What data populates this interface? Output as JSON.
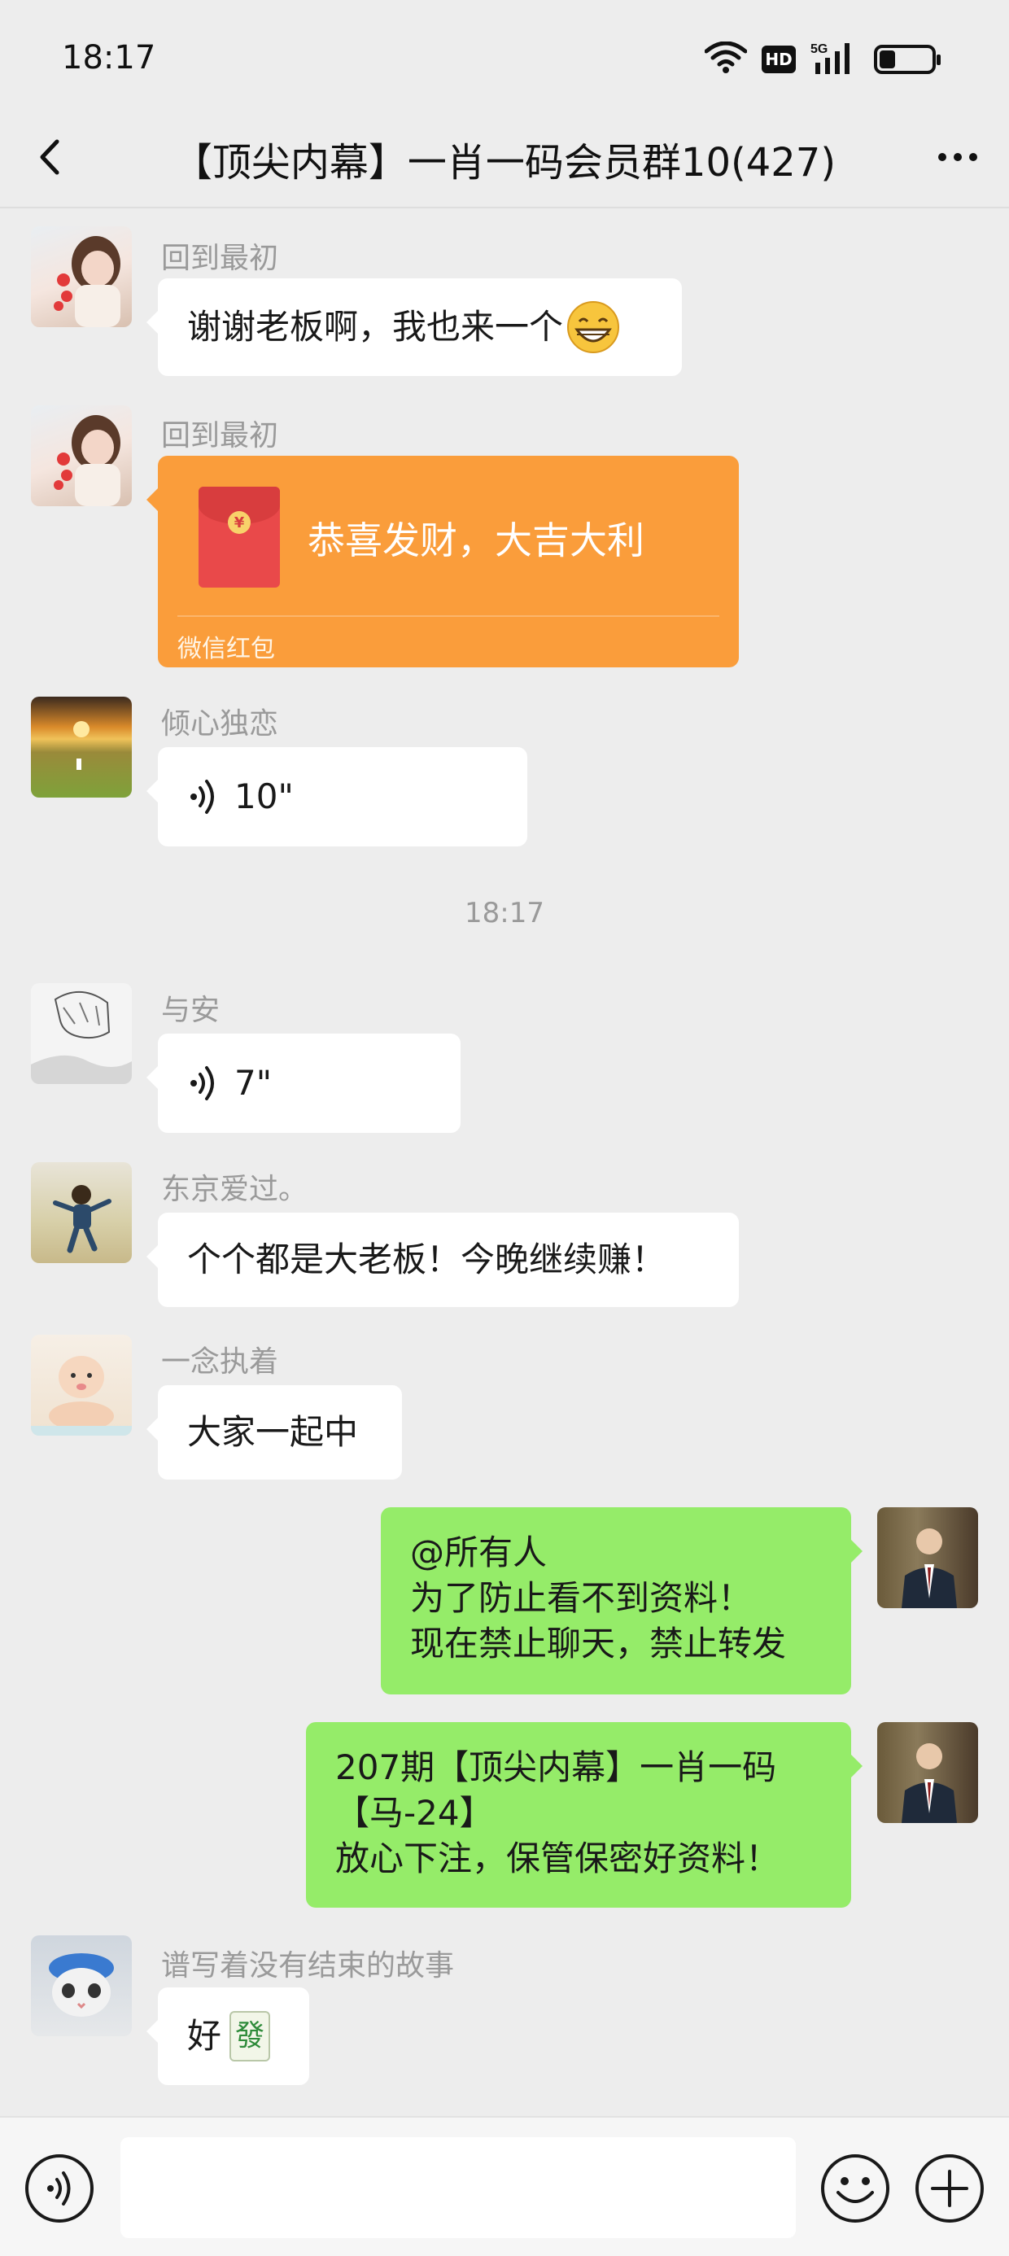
{
  "status_bar": {
    "time": "18:17",
    "hd_label": "HD",
    "network_label": "5G",
    "battery_level": 0.3
  },
  "header": {
    "title": "【顶尖内幕】一肖一码会员群10(427)",
    "back_icon": "chevron-left-icon",
    "more_icon": "more-dots-icon"
  },
  "messages": [
    {
      "sender": "回到最初",
      "text": "谢谢老板啊，我也来一个",
      "emoji": "grin-emoji"
    },
    {
      "sender": "回到最初",
      "red_packet": {
        "title": "恭喜发财，大吉大利",
        "footer": "微信红包",
        "color": "#fa9d3b"
      }
    },
    {
      "sender": "倾心独恋",
      "voice": "10\""
    },
    {
      "timestamp": "18:17"
    },
    {
      "sender": "与安",
      "voice": "7\""
    },
    {
      "sender": "东京爱过。",
      "text": "个个都是大老板！今晚继续赚！"
    },
    {
      "sender": "一念执着",
      "text": "大家一起中"
    },
    {
      "self": true,
      "lines": [
        "@所有人",
        "为了防止看不到资料！",
        "现在禁止聊天，禁止转发"
      ]
    },
    {
      "self": true,
      "lines": [
        "207期【顶尖内幕】一肖一码",
        "【马-24】",
        "放心下注，保管保密好资料！"
      ]
    },
    {
      "sender": "谱写着没有结束的故事",
      "text": "好",
      "emoji": "mahjong-fa-emoji",
      "emoji_glyph": "發"
    }
  ],
  "input_bar": {
    "voice_icon": "voice-input-icon",
    "emoji_icon": "emoji-icon",
    "plus_icon": "plus-icon"
  },
  "colors": {
    "self_bubble": "#95ec69",
    "other_bubble": "#ffffff",
    "background": "#ededed"
  }
}
